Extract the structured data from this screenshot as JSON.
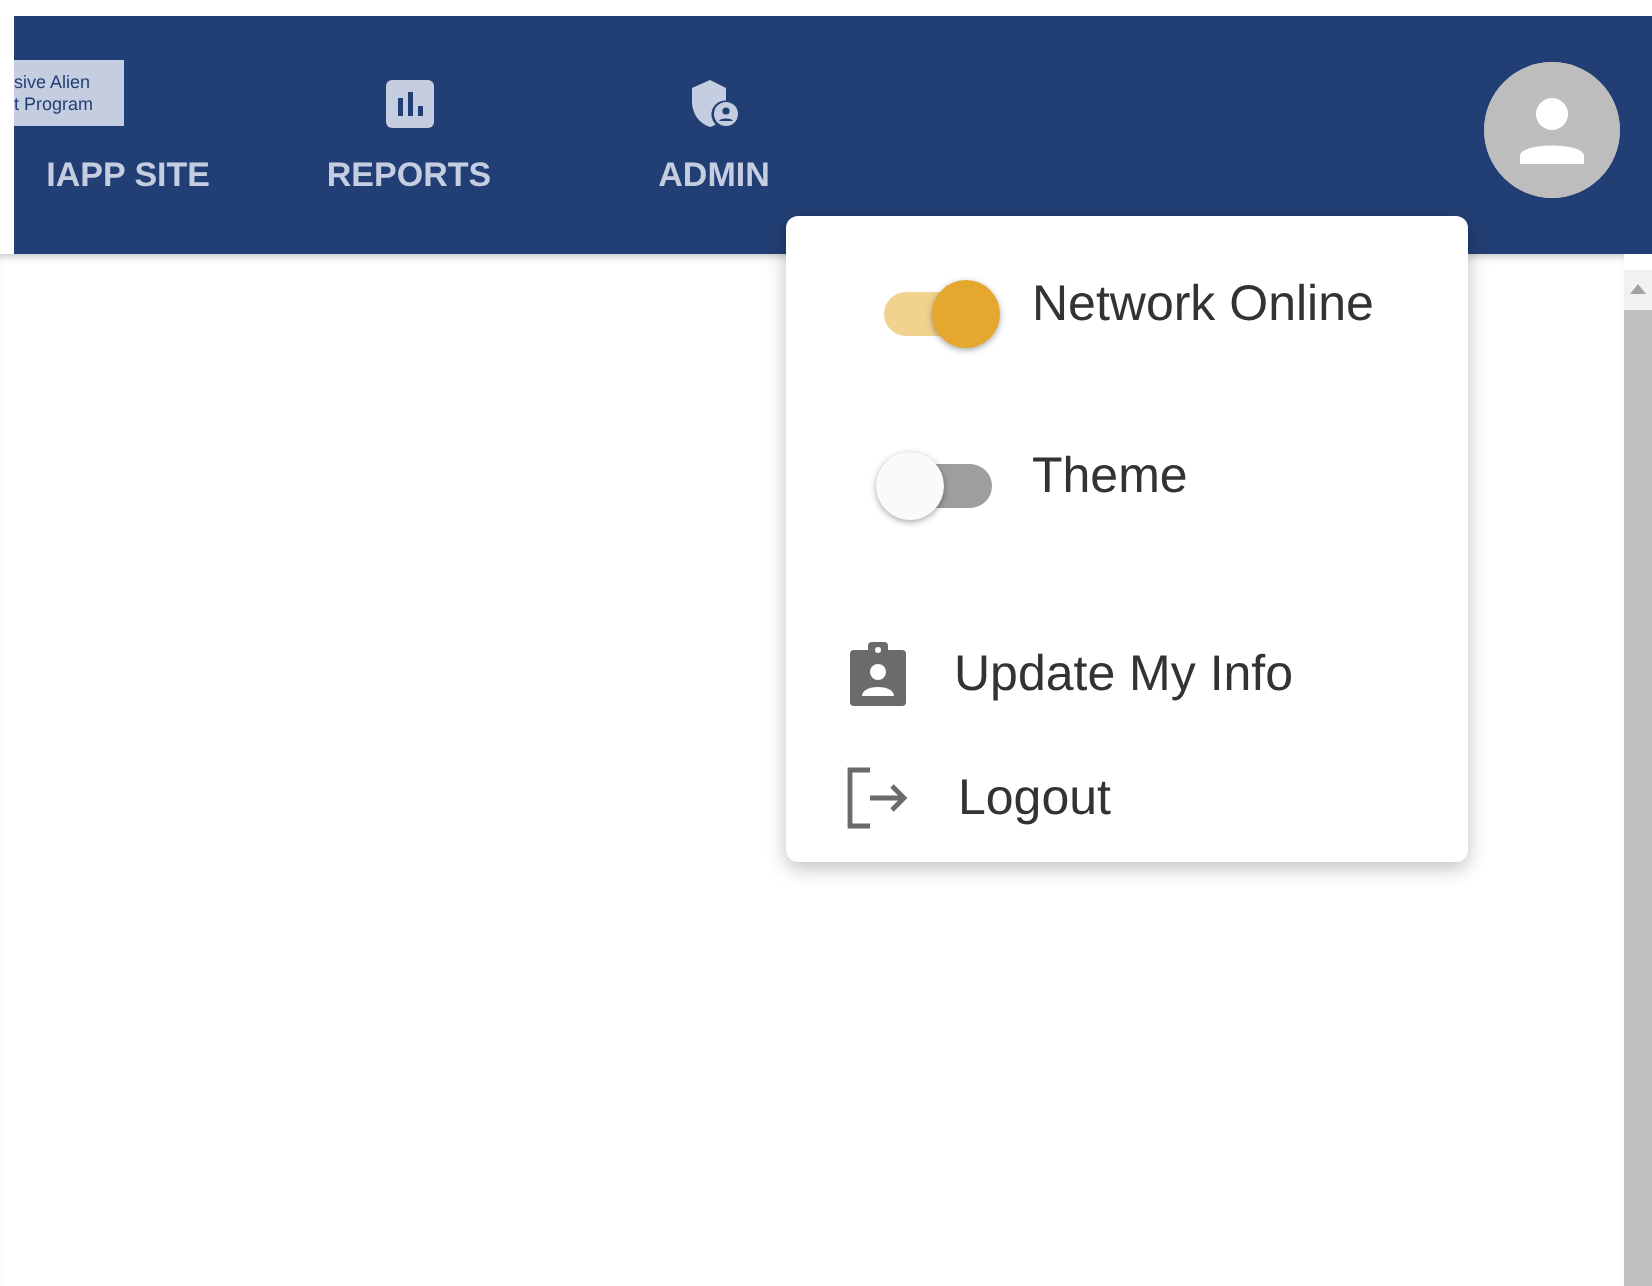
{
  "header": {
    "logo_lines": [
      "sive Alien",
      "t Program"
    ],
    "nav": [
      {
        "label": "IAPP SITE",
        "kind": "plain"
      },
      {
        "label": "REPORTS",
        "kind": "reports"
      },
      {
        "label": "ADMIN",
        "kind": "admin"
      }
    ]
  },
  "menu": {
    "items": [
      {
        "kind": "toggle",
        "label": "Network Online",
        "on": true
      },
      {
        "kind": "toggle",
        "label": "Theme",
        "on": false
      },
      {
        "kind": "info",
        "label": "Update My Info"
      },
      {
        "kind": "logout",
        "label": "Logout"
      }
    ]
  }
}
